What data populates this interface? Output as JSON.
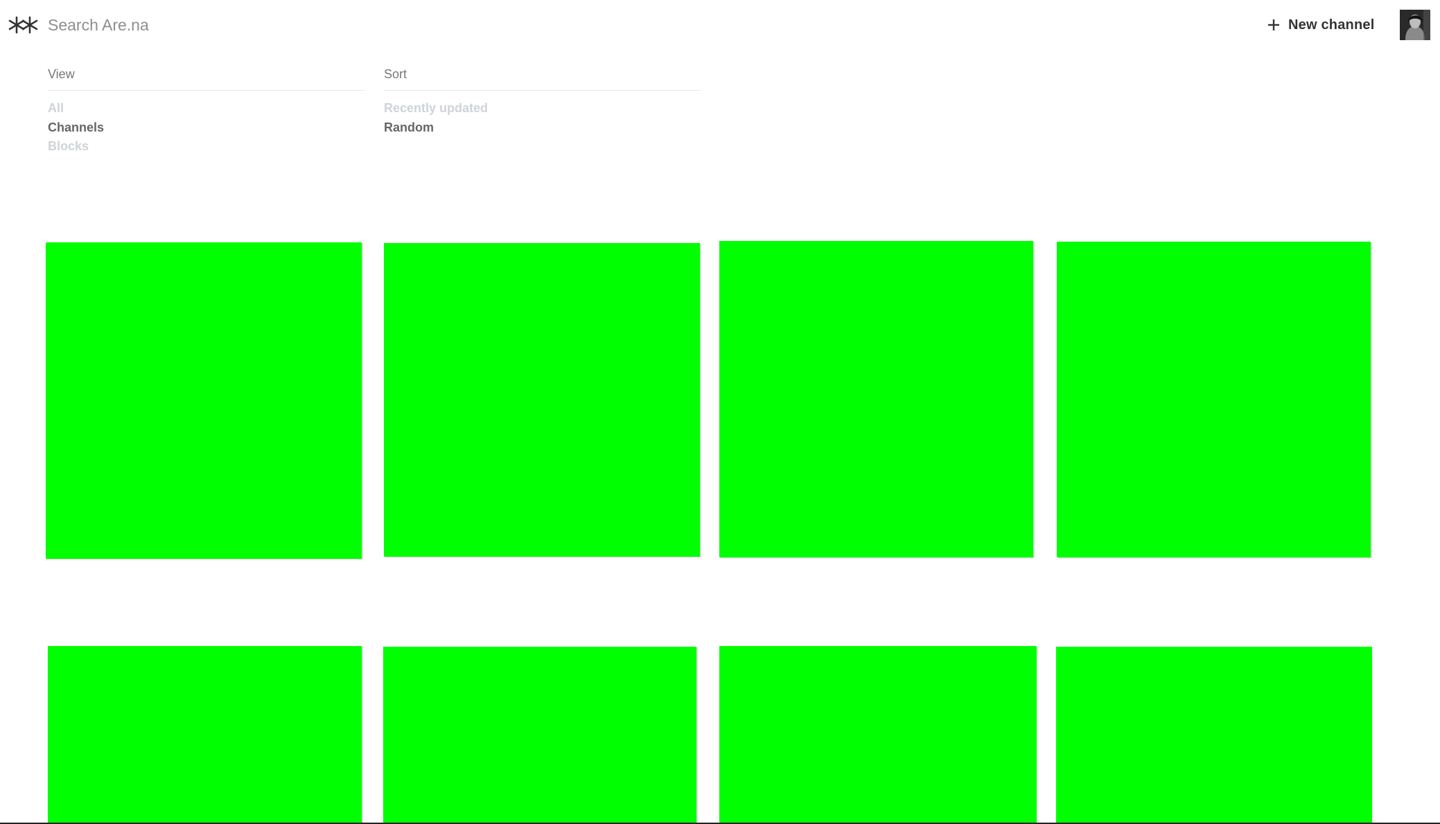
{
  "header": {
    "logo_icon": "arena-asterisks-icon",
    "search_placeholder": "Search Are.na",
    "new_channel_label": "New channel",
    "new_channel_icon": "plus-icon",
    "avatar_icon": "user-avatar"
  },
  "filters": {
    "view": {
      "heading": "View",
      "options": [
        {
          "label": "All",
          "active": false
        },
        {
          "label": "Channels",
          "active": true
        },
        {
          "label": "Blocks",
          "active": false
        }
      ]
    },
    "sort": {
      "heading": "Sort",
      "options": [
        {
          "label": "Recently updated",
          "active": false
        },
        {
          "label": "Random",
          "active": true
        }
      ]
    }
  },
  "grid": {
    "tile_color": "#00ff00",
    "tile_count": 8
  }
}
